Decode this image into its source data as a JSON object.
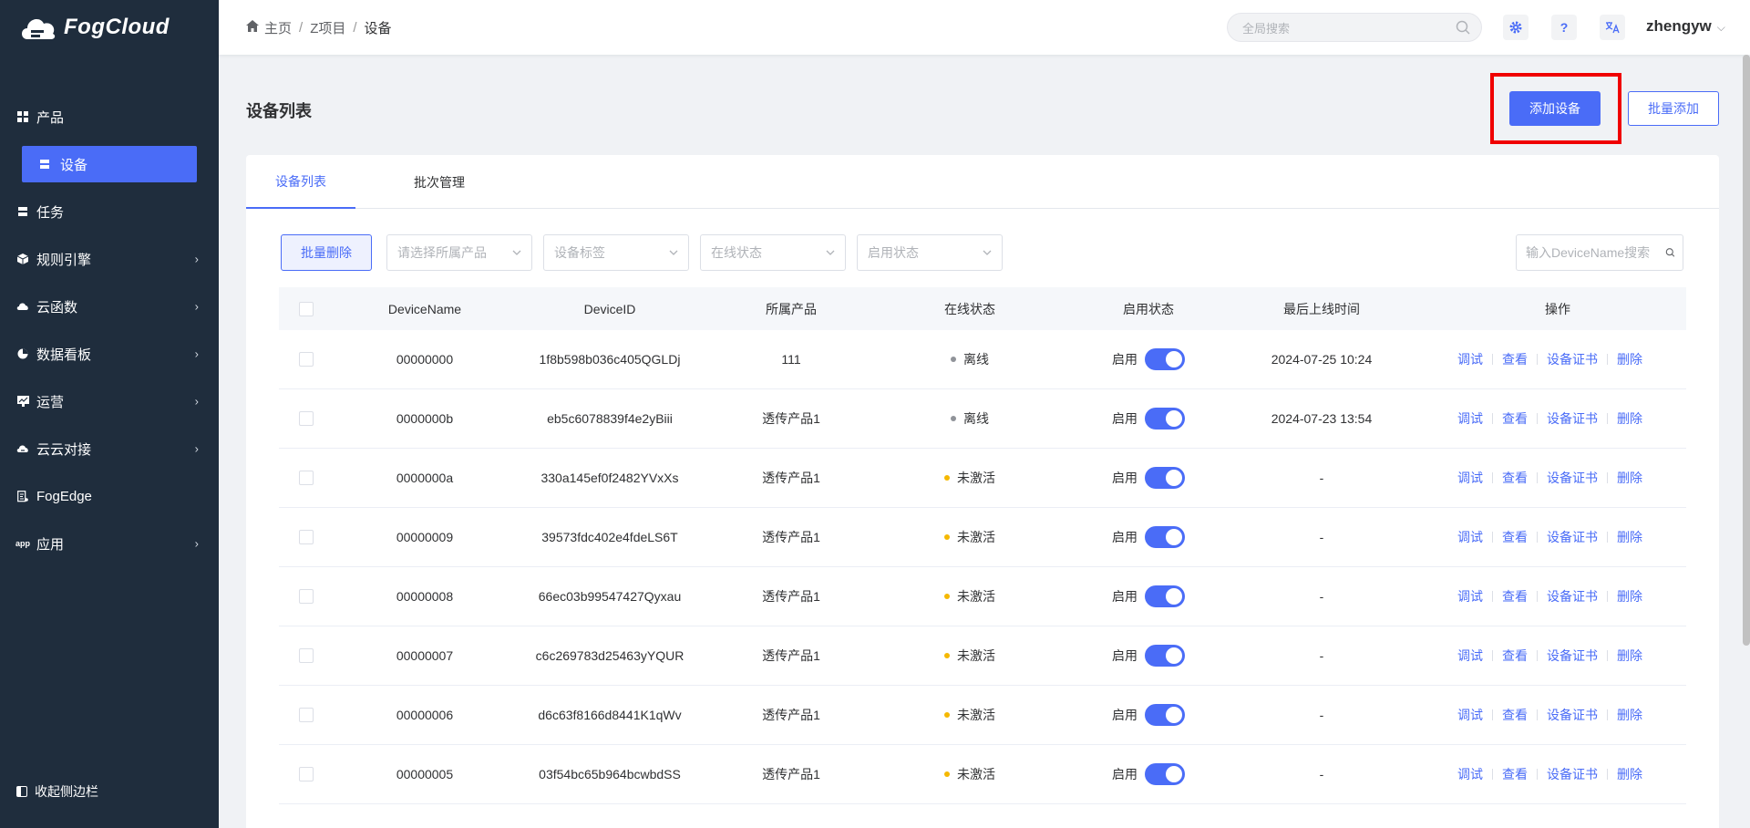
{
  "app": {
    "name": "FogCloud"
  },
  "sidebar": {
    "items": [
      {
        "label": "产品",
        "icon": "grid-icon",
        "has_children": false
      },
      {
        "label": "设备",
        "icon": "device-icon",
        "active": true,
        "sub": true
      },
      {
        "label": "任务",
        "icon": "task-icon",
        "has_children": false
      },
      {
        "label": "规则引擎",
        "icon": "cube-icon",
        "has_children": true
      },
      {
        "label": "云函数",
        "icon": "cloud-icon",
        "has_children": true
      },
      {
        "label": "数据看板",
        "icon": "pie-icon",
        "has_children": true
      },
      {
        "label": "运营",
        "icon": "chart-board-icon",
        "has_children": true
      },
      {
        "label": "云云对接",
        "icon": "cloud-link-icon",
        "has_children": true
      },
      {
        "label": "FogEdge",
        "icon": "edge-icon",
        "has_children": false
      },
      {
        "label": "应用",
        "icon": "app-icon",
        "has_children": true
      }
    ],
    "app_icon_text": "app",
    "collapse_label": "收起侧边栏"
  },
  "header": {
    "breadcrumb": [
      "主页",
      "Z项目",
      "设备"
    ],
    "search_placeholder": "全局搜索",
    "settings_icon": "gear-icon",
    "help_label": "?",
    "translate_icon": "translate-icon",
    "user": "zhengyw"
  },
  "page": {
    "title": "设备列表",
    "add_device_label": "添加设备",
    "batch_add_label": "批量添加"
  },
  "tabs": [
    {
      "label": "设备列表",
      "active": true
    },
    {
      "label": "批次管理",
      "active": false
    }
  ],
  "filters": {
    "batch_delete_label": "批量删除",
    "product_placeholder": "请选择所属产品",
    "tag_placeholder": "设备标签",
    "online_placeholder": "在线状态",
    "enable_placeholder": "启用状态",
    "search_placeholder": "输入DeviceName搜索"
  },
  "table": {
    "headers": [
      "DeviceName",
      "DeviceID",
      "所属产品",
      "在线状态",
      "启用状态",
      "最后上线时间",
      "操作"
    ],
    "actions": [
      "调试",
      "查看",
      "设备证书",
      "删除"
    ],
    "enabled_label": "启用",
    "status_colors": {
      "离线": "#909399",
      "未激活": "#f5b800"
    },
    "rows": [
      {
        "name": "00000000",
        "id": "1f8b598b036c405QGLDj",
        "product": "111",
        "status": "离线",
        "last_online": "2024-07-25 10:24"
      },
      {
        "name": "0000000b",
        "id": "eb5c6078839f4e2yBiii",
        "product": "透传产品1",
        "status": "离线",
        "last_online": "2024-07-23 13:54"
      },
      {
        "name": "0000000a",
        "id": "330a145ef0f2482YVxXs",
        "product": "透传产品1",
        "status": "未激活",
        "last_online": "-"
      },
      {
        "name": "00000009",
        "id": "39573fdc402e4fdeLS6T",
        "product": "透传产品1",
        "status": "未激活",
        "last_online": "-"
      },
      {
        "name": "00000008",
        "id": "66ec03b99547427Qyxau",
        "product": "透传产品1",
        "status": "未激活",
        "last_online": "-"
      },
      {
        "name": "00000007",
        "id": "c6c269783d25463yYQUR",
        "product": "透传产品1",
        "status": "未激活",
        "last_online": "-"
      },
      {
        "name": "00000006",
        "id": "d6c63f8166d8441K1qWv",
        "product": "透传产品1",
        "status": "未激活",
        "last_online": "-"
      },
      {
        "name": "00000005",
        "id": "03f54bc65b964bcwbdSS",
        "product": "透传产品1",
        "status": "未激活",
        "last_online": "-"
      }
    ]
  },
  "colors": {
    "accent": "#4a6cf7",
    "sidebar_bg": "#1f2d3d",
    "highlight_box": "#f00000"
  }
}
